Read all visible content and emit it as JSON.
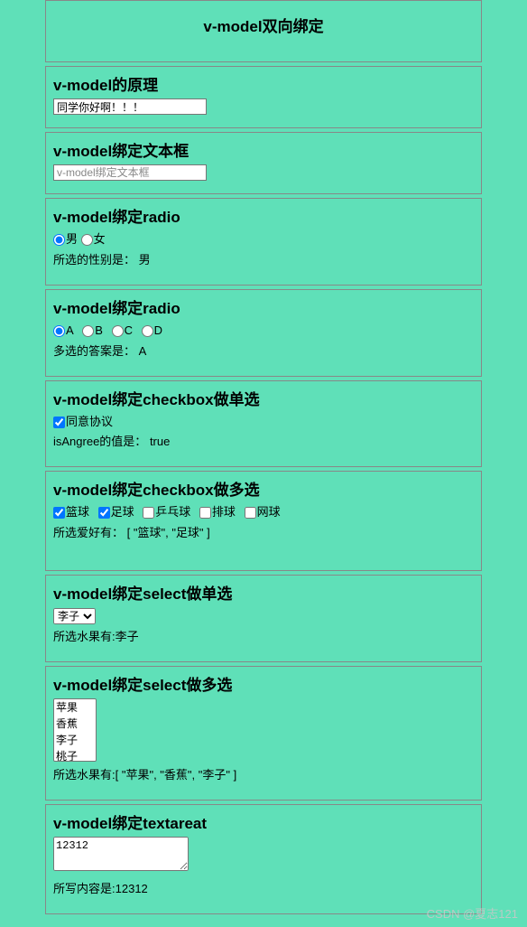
{
  "title": "v-model双向绑定",
  "section1": {
    "heading": "v-model的原理",
    "inputValue": "同学你好啊！！！"
  },
  "section2": {
    "heading": "v-model绑定文本框",
    "placeholder": "v-model绑定文本框"
  },
  "section3": {
    "heading": "v-model绑定radio",
    "opt1": "男",
    "opt2": "女",
    "resultLabel": "所选的性别是：",
    "resultValue": "男"
  },
  "section4": {
    "heading": "v-model绑定radio",
    "optA": "A",
    "optB": "B",
    "optC": "C",
    "optD": "D",
    "resultLabel": "多选的答案是：",
    "resultValue": "A"
  },
  "section5": {
    "heading": "v-model绑定checkbox做单选",
    "checkLabel": "同意协议",
    "resultLabel": "isAngree的值是：",
    "resultValue": "true"
  },
  "section6": {
    "heading": "v-model绑定checkbox做多选",
    "c1": "篮球",
    "c2": "足球",
    "c3": "乒乓球",
    "c4": "排球",
    "c5": "网球",
    "resultLabel": "所选爱好有：",
    "resultValue": "[ \"篮球\", \"足球\" ]"
  },
  "section7": {
    "heading": "v-model绑定select做单选",
    "selected": "李子",
    "resultLabel": "所选水果有:",
    "resultValue": "李子"
  },
  "section8": {
    "heading": "v-model绑定select做多选",
    "o1": "苹果",
    "o2": "香蕉",
    "o3": "李子",
    "o4": "桃子",
    "resultLabel": "所选水果有:",
    "resultValue": "[ \"苹果\", \"香蕉\", \"李子\" ]"
  },
  "section9": {
    "heading": "v-model绑定textareat",
    "value": "12312",
    "resultLabel": "所写内容是:",
    "resultValue": "12312"
  },
  "watermark": "CSDN @夏志121"
}
